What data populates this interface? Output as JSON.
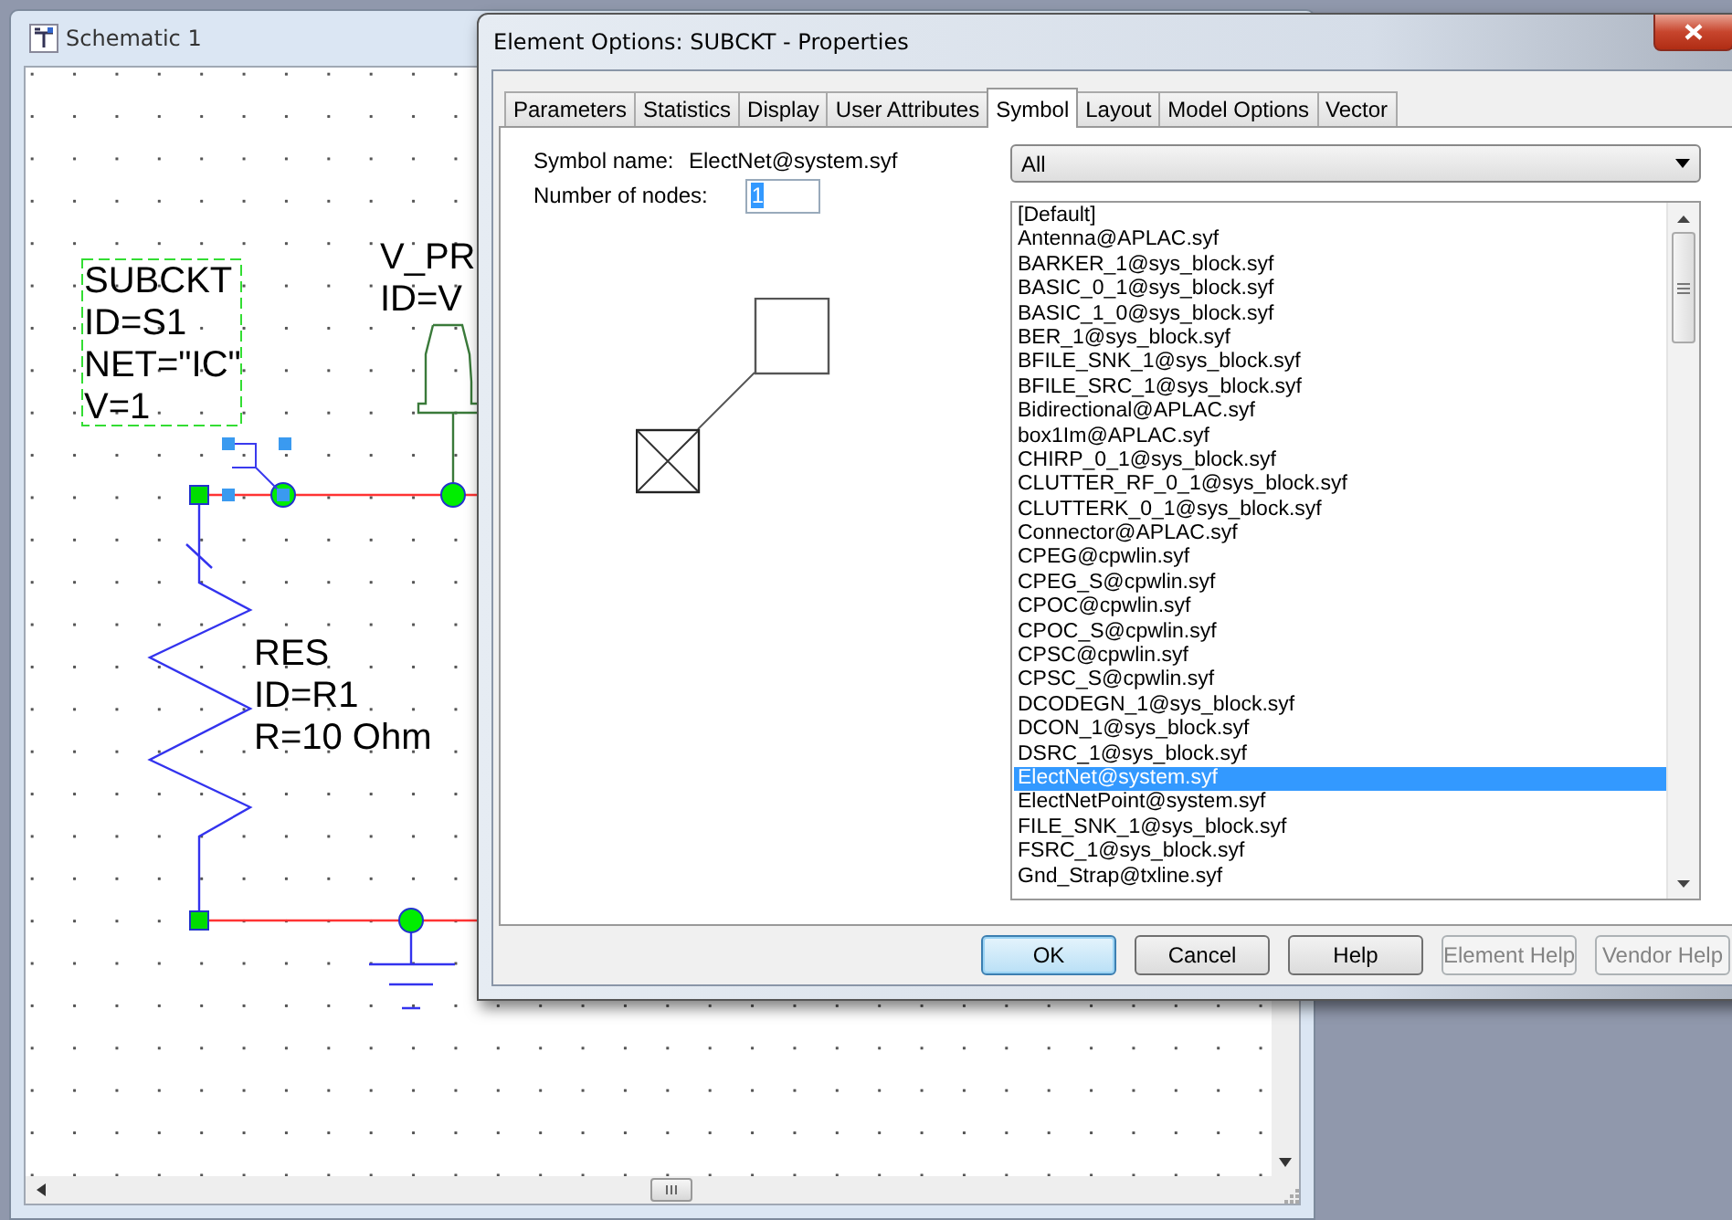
{
  "schematic": {
    "title": "Schematic 1",
    "labels": [
      {
        "kind": "subckt",
        "lines": [
          "SUBCKT",
          "ID=S1",
          "NET=\"IC\"",
          "V=1"
        ]
      },
      {
        "kind": "probe",
        "lines": [
          "V_PR",
          "ID=V"
        ]
      },
      {
        "kind": "resistor",
        "lines": [
          "RES",
          "ID=R1",
          "R=10 Ohm"
        ]
      }
    ]
  },
  "dialog": {
    "title": "Element Options: SUBCKT -  Properties",
    "tabs": [
      {
        "label": "Parameters",
        "selected": false
      },
      {
        "label": "Statistics",
        "selected": false
      },
      {
        "label": "Display",
        "selected": false
      },
      {
        "label": "User Attributes",
        "selected": false
      },
      {
        "label": "Symbol",
        "selected": true
      },
      {
        "label": "Layout",
        "selected": false
      },
      {
        "label": "Model Options",
        "selected": false
      },
      {
        "label": "Vector",
        "selected": false
      }
    ],
    "symbol_name": {
      "label": "Symbol name:",
      "value": "ElectNet@system.syf"
    },
    "nodes": {
      "label": "Number of nodes:",
      "value": "1",
      "selected": true
    },
    "filter": {
      "value": "All"
    },
    "symbols": [
      {
        "label": "[Default]",
        "selected": false
      },
      {
        "label": "Antenna@APLAC.syf",
        "selected": false
      },
      {
        "label": "BARKER_1@sys_block.syf",
        "selected": false
      },
      {
        "label": "BASIC_0_1@sys_block.syf",
        "selected": false
      },
      {
        "label": "BASIC_1_0@sys_block.syf",
        "selected": false
      },
      {
        "label": "BER_1@sys_block.syf",
        "selected": false
      },
      {
        "label": "BFILE_SNK_1@sys_block.syf",
        "selected": false
      },
      {
        "label": "BFILE_SRC_1@sys_block.syf",
        "selected": false
      },
      {
        "label": "Bidirectional@APLAC.syf",
        "selected": false
      },
      {
        "label": "box1Im@APLAC.syf",
        "selected": false
      },
      {
        "label": "CHIRP_0_1@sys_block.syf",
        "selected": false
      },
      {
        "label": "CLUTTER_RF_0_1@sys_block.syf",
        "selected": false
      },
      {
        "label": "CLUTTERK_0_1@sys_block.syf",
        "selected": false
      },
      {
        "label": "Connector@APLAC.syf",
        "selected": false
      },
      {
        "label": "CPEG@cpwlin.syf",
        "selected": false
      },
      {
        "label": "CPEG_S@cpwlin.syf",
        "selected": false
      },
      {
        "label": "CPOC@cpwlin.syf",
        "selected": false
      },
      {
        "label": "CPOC_S@cpwlin.syf",
        "selected": false
      },
      {
        "label": "CPSC@cpwlin.syf",
        "selected": false
      },
      {
        "label": "CPSC_S@cpwlin.syf",
        "selected": false
      },
      {
        "label": "DCODEGN_1@sys_block.syf",
        "selected": false
      },
      {
        "label": "DCON_1@sys_block.syf",
        "selected": false
      },
      {
        "label": "DSRC_1@sys_block.syf",
        "selected": false
      },
      {
        "label": "ElectNet@system.syf",
        "selected": true
      },
      {
        "label": "ElectNetPoint@system.syf",
        "selected": false
      },
      {
        "label": "FILE_SNK_1@sys_block.syf",
        "selected": false
      },
      {
        "label": "FSRC_1@sys_block.syf",
        "selected": false
      },
      {
        "label": "Gnd_Strap@txline.syf",
        "selected": false
      }
    ],
    "buttons": [
      {
        "label": "OK",
        "default": true,
        "disabled": false
      },
      {
        "label": "Cancel",
        "default": false,
        "disabled": false
      },
      {
        "label": "Help",
        "default": false,
        "disabled": false
      },
      {
        "label": "Element Help",
        "default": false,
        "disabled": true
      },
      {
        "label": "Vendor Help",
        "default": false,
        "disabled": true
      }
    ]
  }
}
